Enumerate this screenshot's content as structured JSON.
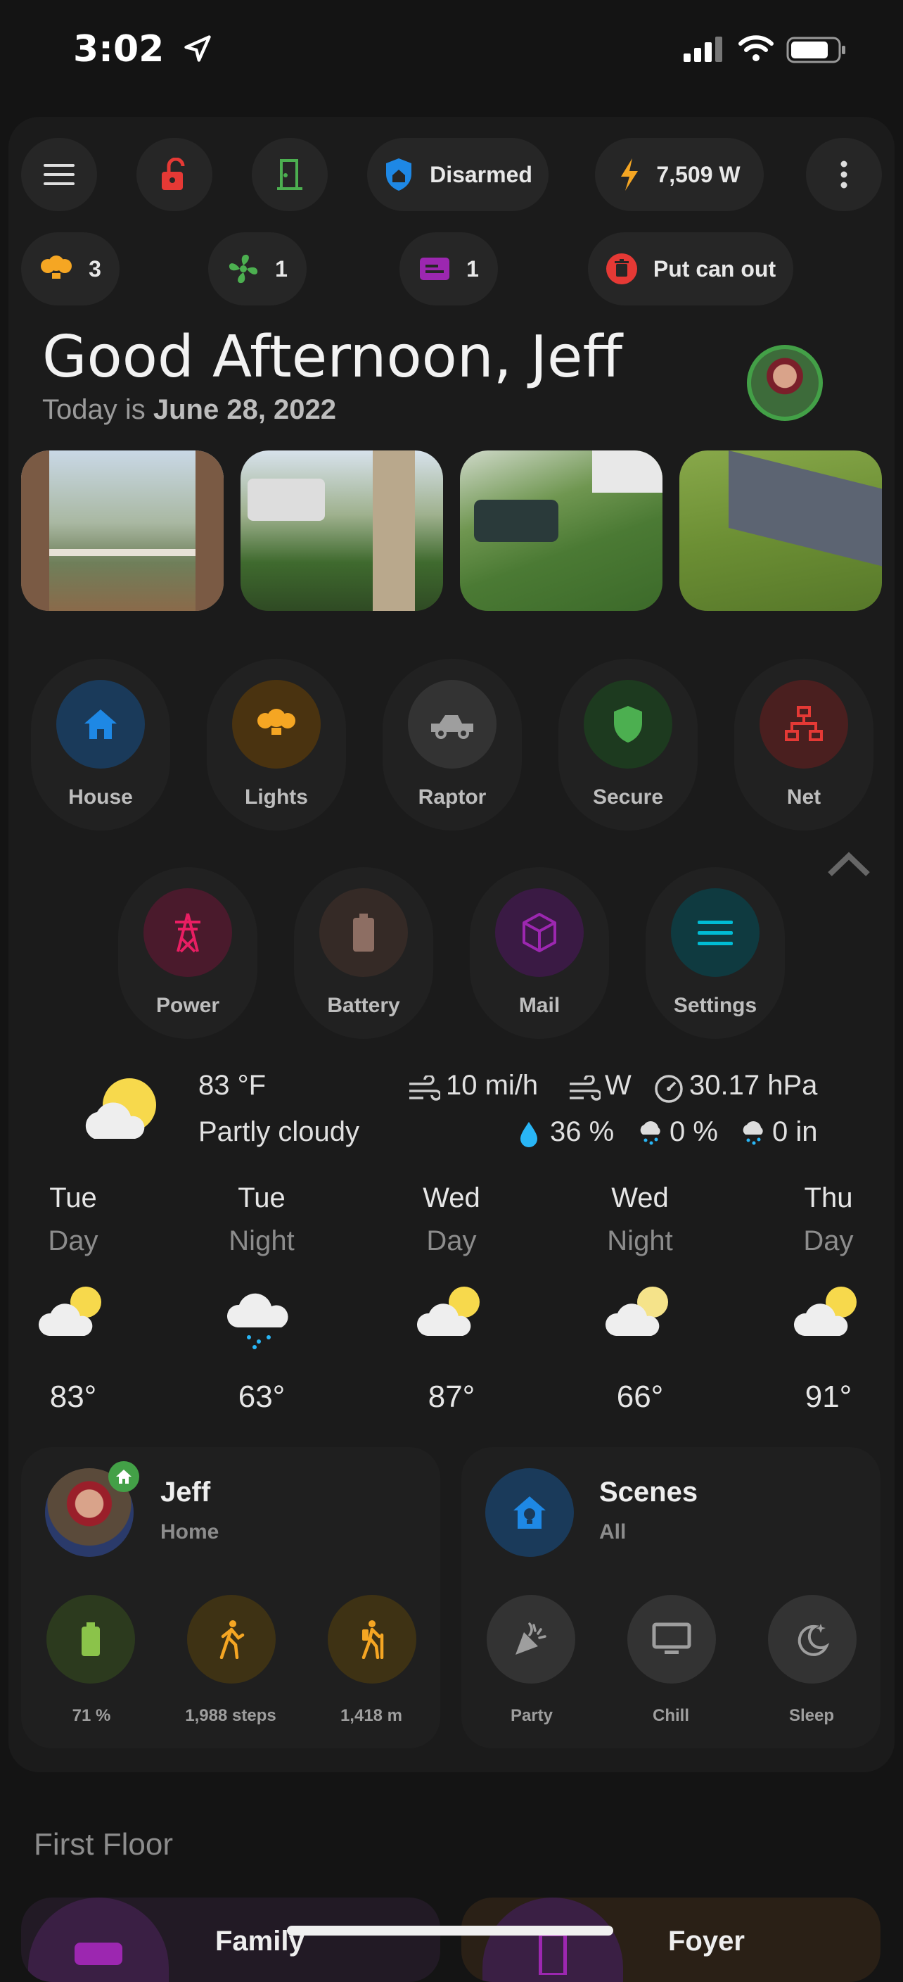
{
  "status_bar": {
    "time": "3:02"
  },
  "top_chips": {
    "alarm": "Disarmed",
    "power": "7,509 W",
    "lights_count": "3",
    "fans_count": "1",
    "mail_count": "1",
    "trash": "Put can out"
  },
  "greeting": {
    "title": "Good Afternoon, Jeff",
    "date_prefix": "Today is ",
    "date": "June 28, 2022"
  },
  "nav_tiles": [
    {
      "label": "House",
      "icon": "home-icon",
      "color": "#1e88e5"
    },
    {
      "label": "Lights",
      "icon": "lightbulb-group-icon",
      "color": "#f5a623"
    },
    {
      "label": "Raptor",
      "icon": "truck-icon",
      "color": "#9e9e9e"
    },
    {
      "label": "Secure",
      "icon": "shield-icon",
      "color": "#4caf50"
    },
    {
      "label": "Net",
      "icon": "network-icon",
      "color": "#e53935"
    },
    {
      "label": "Power",
      "icon": "transmission-tower-icon",
      "color": "#e91e63"
    },
    {
      "label": "Battery",
      "icon": "battery-icon",
      "color": "#8d6e63"
    },
    {
      "label": "Mail",
      "icon": "package-icon",
      "color": "#9c27b0"
    },
    {
      "label": "Settings",
      "icon": "menu-icon",
      "color": "#00bcd4"
    }
  ],
  "weather": {
    "temp": "83 °F",
    "condition": "Partly cloudy",
    "wind_speed": "10 mi/h",
    "wind_dir": "W",
    "pressure": "30.17 hPa",
    "humidity": "36 %",
    "precip_prob": "0 %",
    "precip": "0 in",
    "forecast": [
      {
        "d1": "Tue",
        "d2": "Day",
        "temp": "83°",
        "icon": "partly-cloudy-icon"
      },
      {
        "d1": "Tue",
        "d2": "Night",
        "temp": "63°",
        "icon": "rainy-icon"
      },
      {
        "d1": "Wed",
        "d2": "Day",
        "temp": "87°",
        "icon": "partly-cloudy-icon"
      },
      {
        "d1": "Wed",
        "d2": "Night",
        "temp": "66°",
        "icon": "partly-cloudy-night-icon"
      },
      {
        "d1": "Thu",
        "d2": "Day",
        "temp": "91°",
        "icon": "partly-cloudy-icon"
      }
    ]
  },
  "person": {
    "name": "Jeff",
    "state": "Home",
    "battery": "71 %",
    "steps": "1,988 steps",
    "distance": "1,418 m"
  },
  "scenes": {
    "title": "Scenes",
    "subtitle": "All",
    "items": [
      "Party",
      "Chill",
      "Sleep"
    ]
  },
  "floor": {
    "title": "First Floor",
    "rooms": [
      "Family",
      "Foyer"
    ]
  }
}
